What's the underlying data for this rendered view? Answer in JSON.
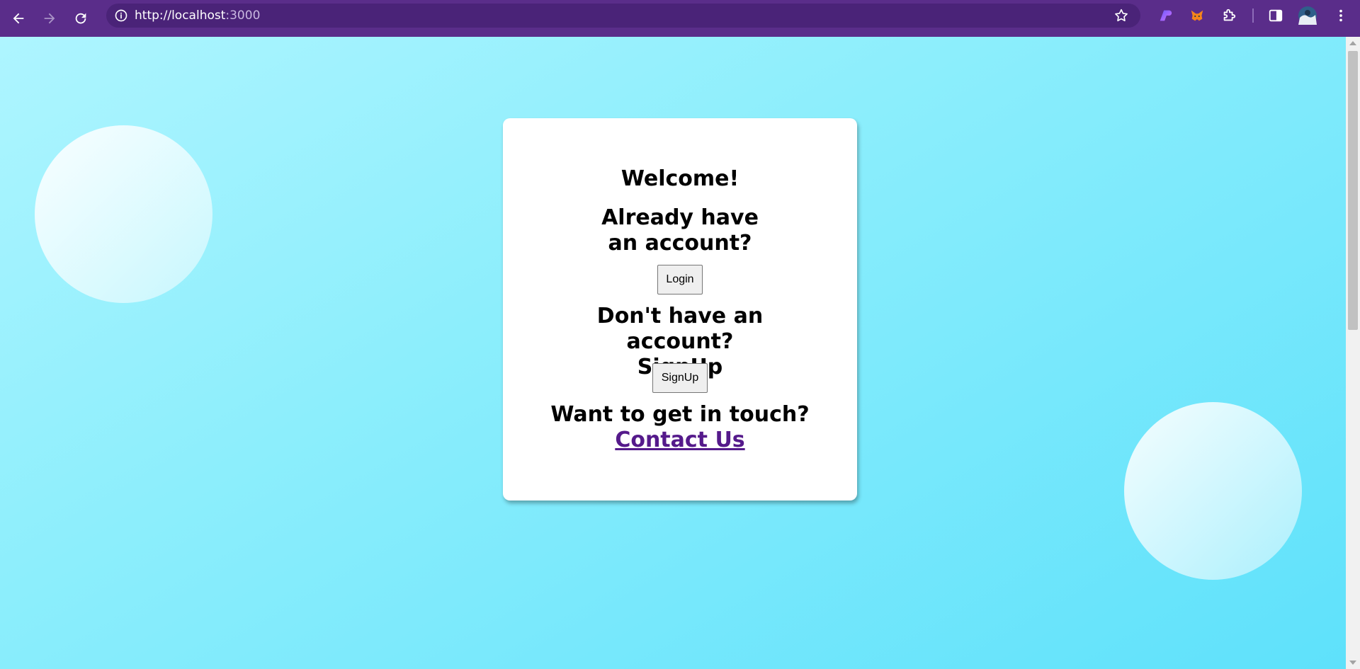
{
  "browser": {
    "url_host": "http://localhost",
    "url_port": ":3000",
    "icons": {
      "back": "back-arrow-icon",
      "forward": "forward-arrow-icon",
      "reload": "reload-icon",
      "info": "site-info-icon",
      "bookmark": "star-icon",
      "extensions": [
        "gradient-extension-icon",
        "metamask-fox-icon",
        "puzzle-extensions-icon"
      ],
      "side_panel": "side-panel-icon",
      "profile": "profile-avatar",
      "menu": "kebab-menu-icon"
    },
    "toolbar_color": "#5a2d8a"
  },
  "page": {
    "background_colors": [
      "#aef5ff",
      "#5ee1fb"
    ],
    "card": {
      "welcome": "Welcome!",
      "login_prompt": "Already have an account?",
      "login_button": "Login",
      "signup_prompt": "Don't have an account? SignUp",
      "signup_button": "SignUp",
      "contact_prompt": "Want to get in touch?",
      "contact_link": "Contact Us"
    },
    "link_color": "#551a8b"
  }
}
